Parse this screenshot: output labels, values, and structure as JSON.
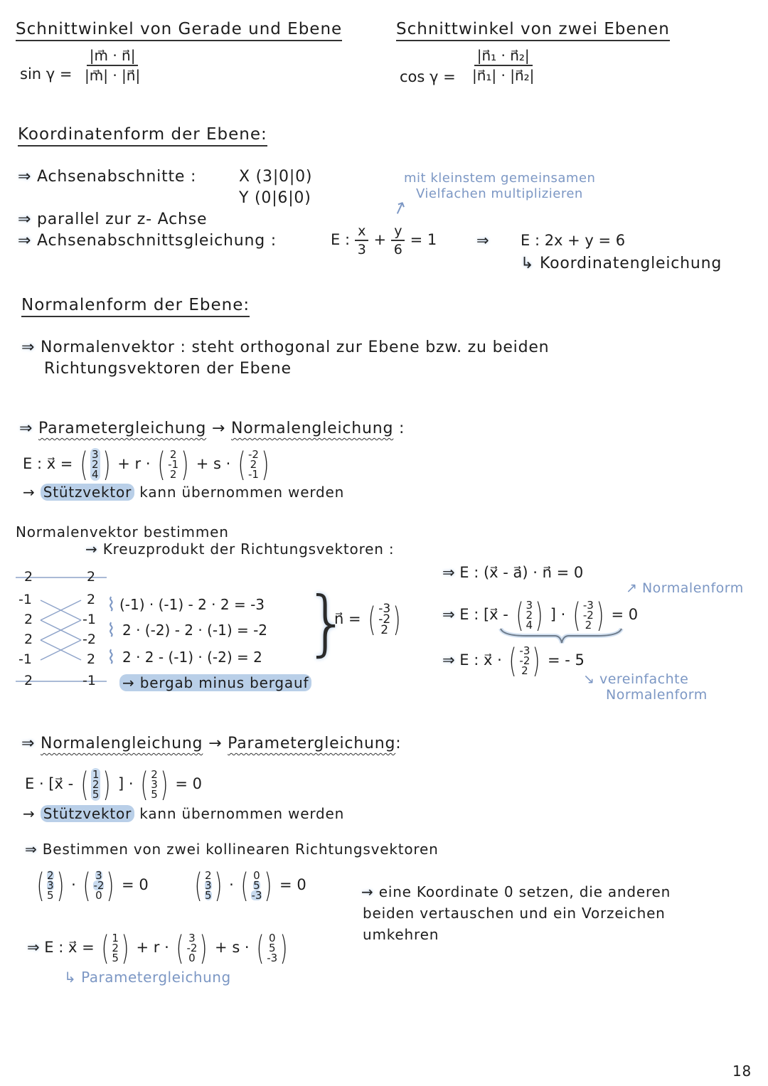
{
  "page_number": "18",
  "colors": {
    "ink": "#1d1d1d",
    "accent_blue": "#7c97c4",
    "highlight": "#b9cfe8"
  },
  "section_angle_line_plane": {
    "title": "Schnittwinkel von Gerade und Ebene",
    "lhs": "sin γ =",
    "numerator": "|m⃗ · n⃗|",
    "denominator": "|m⃗| · |n⃗|"
  },
  "section_angle_planes": {
    "title": "Schnittwinkel von zwei Ebenen",
    "lhs": "cos γ =",
    "numerator": "|n⃗₁ · n⃗₂|",
    "denominator": "|n⃗₁| · |n⃗₂|"
  },
  "section_coordinate_form": {
    "title": "Koordinatenform der Ebene:",
    "intercepts_label": "Achsenabschnitte :",
    "intercept_x": "X (3|0|0)",
    "intercept_y": "Y (0|6|0)",
    "parallel": "parallel zur z- Achse",
    "intercept_eq_label": "Achsenabschnittsgleichung :",
    "eq_prefix": "E :",
    "frac1": {
      "num": "x",
      "den": "3"
    },
    "plus": "+",
    "frac2": {
      "num": "y",
      "den": "6"
    },
    "eq_rhs": "= 1",
    "implies": "⇒",
    "coordinate_eq": "E : 2x + y = 6",
    "coordinate_eq_note": "Koordinatengleichung",
    "annotation_line1": "mit kleinstem gemeinsamen",
    "annotation_line2": "Vielfachen multiplizieren"
  },
  "section_normal_form": {
    "title": "Normalenform der Ebene:",
    "normal_vector_line1": "Normalenvektor : steht orthogonal zur Ebene bzw. zu beiden",
    "normal_vector_line2": "Richtungsvektoren der Ebene"
  },
  "param_to_normal": {
    "heading_left": "Parametergleichung",
    "heading_arrow": "→",
    "heading_right": "Normalengleichung",
    "heading_colon": ":",
    "eq_prefix": "E : x⃗ =",
    "support": [
      "3",
      "2",
      "4"
    ],
    "r_label": "+ r ·",
    "dir1": [
      "2",
      "-1",
      "2"
    ],
    "s_label": "+ s ·",
    "dir2": [
      "-2",
      "2",
      "-1"
    ],
    "note_highlight": "Stützvektor",
    "note_rest": "kann übernommen werden",
    "normal_heading": "Normalenvektor bestimmen",
    "cross_heading": "Kreuzprodukt der Richtungsvektoren :",
    "cross_left": [
      "2",
      "-1",
      "2",
      "2",
      "-1",
      "2"
    ],
    "cross_right": [
      "2",
      "2",
      "-1",
      "-2",
      "2",
      "-1"
    ],
    "cross_calcs": [
      "(-1) · (-1) - 2 · 2  = -3",
      "2 · (-2) - 2 · (-1) = -2",
      "2 · 2 - (-1) · (-2) = 2"
    ],
    "cross_rule": "→ bergab minus bergauf",
    "n_label": "n⃗ =",
    "n_vec": [
      "-3",
      "-2",
      "2"
    ],
    "steps": {
      "s1": "E : (x⃗ - a⃗) · n⃗ = 0",
      "s2_prefix": "E : [x⃗ -",
      "s2_support": [
        "3",
        "2",
        "4"
      ],
      "s2_mid": "] ·",
      "s2_n": [
        "-3",
        "-2",
        "2"
      ],
      "s2_rhs": "= 0",
      "s2_note": "Normalenform",
      "s3_prefix": "E :  x⃗ ·",
      "s3_n": [
        "-3",
        "-2",
        "2"
      ],
      "s3_rhs": "= - 5",
      "s3_note_line1": "vereinfachte",
      "s3_note_line2": "Normalenform"
    }
  },
  "normal_to_param": {
    "heading_left": "Normalengleichung",
    "heading_arrow": "→",
    "heading_right": "Parametergleichung",
    "heading_colon": ":",
    "eq_prefix": "E · [x⃗ -",
    "support": [
      "1",
      "2",
      "5"
    ],
    "eq_mid": "] ·",
    "normal": [
      "2",
      "3",
      "5"
    ],
    "eq_rhs": "= 0",
    "note_highlight": "Stützvektor",
    "note_rest": "kann übernommen werden",
    "collinear_heading": "Bestimmen von zwei kollinearen Richtungsvektoren",
    "dot1_a": [
      "2",
      "3",
      "5"
    ],
    "dot1_b": [
      "3",
      "-2",
      "0"
    ],
    "dot2_a": [
      "2",
      "3",
      "5"
    ],
    "dot2_b": [
      "0",
      "5",
      "-3"
    ],
    "dot_rhs": "= 0",
    "rule_line1": "eine Koordinate 0 setzen, die anderen",
    "rule_line2": "beiden vertauschen und ein Vorzeichen",
    "rule_line3": "umkehren",
    "final_prefix": "E : x⃗ =",
    "final_support": [
      "1",
      "2",
      "5"
    ],
    "final_r": "+ r ·",
    "final_dir1": [
      "3",
      "-2",
      "0"
    ],
    "final_s": "+ s ·",
    "final_dir2": [
      "0",
      "5",
      "-3"
    ],
    "final_note": "Parametergleichung"
  }
}
